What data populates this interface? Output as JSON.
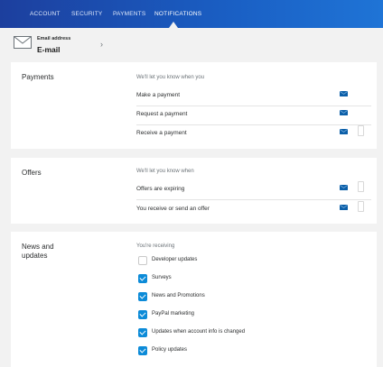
{
  "nav": {
    "tabs": [
      {
        "label": "ACCOUNT"
      },
      {
        "label": "SECURITY"
      },
      {
        "label": "PAYMENTS"
      },
      {
        "label": "NOTIFICATIONS",
        "active": true
      }
    ]
  },
  "email": {
    "label": "Email address",
    "value": "E-mail"
  },
  "payments": {
    "title": "Payments",
    "subtitle": "We'll let you know when you",
    "rows": [
      {
        "label": "Make a payment"
      },
      {
        "label": "Request a payment"
      },
      {
        "label": "Receive a payment"
      }
    ]
  },
  "offers": {
    "title": "Offers",
    "subtitle": "We'll let you know when",
    "rows": [
      {
        "label": "Offers are expiring"
      },
      {
        "label": "You receive or send an offer"
      }
    ]
  },
  "news": {
    "title_line1": "News and",
    "title_line2": "updates",
    "subtitle": "You're receiving",
    "items": [
      {
        "label": "Developer updates",
        "checked": false
      },
      {
        "label": "Surveys",
        "checked": true
      },
      {
        "label": "News and Promotions",
        "checked": true
      },
      {
        "label": "PayPal marketing",
        "checked": true
      },
      {
        "label": "Updates when account info is changed",
        "checked": true
      },
      {
        "label": "Policy updates",
        "checked": true
      }
    ]
  },
  "colors": {
    "nav_start": "#1c3f9e",
    "nav_end": "#1f74d6",
    "checkbox_on": "#0c8bd8",
    "envelope": "#0c5fa8"
  }
}
